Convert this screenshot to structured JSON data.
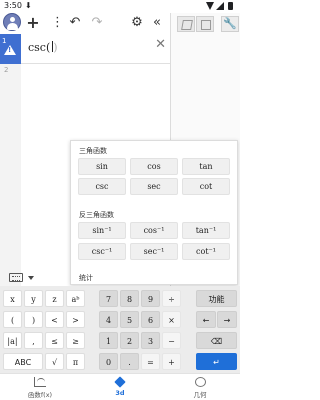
{
  "status": {
    "time": "3:50",
    "download_indicator": "⬇"
  },
  "toolbar": {
    "add_label": "+",
    "menu_label": "⋮",
    "undo_label": "↶",
    "redo_label": "↷",
    "settings_label": "⚙",
    "collapse_label": "«"
  },
  "graphics": {
    "wrench_label": "🔧"
  },
  "algebra": {
    "row_number": "1",
    "row2_number": "2",
    "input_fn": "csc",
    "input_open": "(",
    "input_close": ")",
    "clear_label": "✕"
  },
  "popup": {
    "trig_title": "三角函数",
    "trig": [
      "sin",
      "cos",
      "tan",
      "csc",
      "sec",
      "cot"
    ],
    "inverse_title": "反三角函数",
    "inverse": [
      "sin⁻¹",
      "cos⁻¹",
      "tan⁻¹",
      "csc⁻¹",
      "sec⁻¹",
      "cot⁻¹"
    ],
    "stats_title": "统计"
  },
  "keyboard": {
    "rows": [
      [
        "x",
        "y",
        "z",
        "aᵇ",
        "7",
        "8",
        "9",
        "÷",
        "功能"
      ],
      [
        "(",
        ")",
        "<",
        ">",
        "4",
        "5",
        "6",
        "×",
        "←",
        "→"
      ],
      [
        "|a|",
        ",",
        "≤",
        "≥",
        "1",
        "2",
        "3",
        "−",
        "⌫"
      ],
      [
        "ABC",
        "√",
        "π",
        "0",
        ".",
        "=",
        "+",
        "↵"
      ]
    ]
  },
  "bottomnav": {
    "items": [
      "函数f(x)",
      "3d",
      "几何"
    ],
    "active_index": 1
  }
}
